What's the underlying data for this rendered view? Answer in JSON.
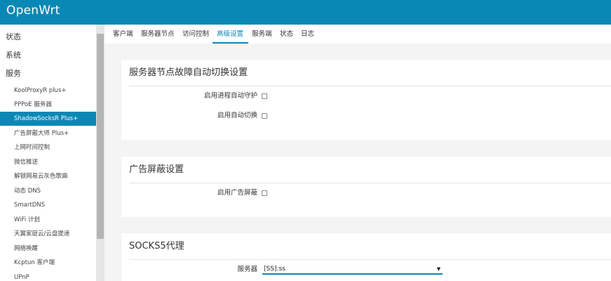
{
  "app": {
    "brand": "OpenWrt"
  },
  "colors": {
    "accent": "#0a88b5"
  },
  "sidebar": {
    "sections": [
      {
        "label": "状态"
      },
      {
        "label": "系统"
      },
      {
        "label": "服务"
      }
    ],
    "items": [
      {
        "label": "KoolProxyR plus+"
      },
      {
        "label": "PPPoE 服务器"
      },
      {
        "label": "ShadowSocksR Plus+",
        "active": true
      },
      {
        "label": "广告屏蔽大师 Plus+"
      },
      {
        "label": "上网时间控制"
      },
      {
        "label": "微信推送"
      },
      {
        "label": "解锁网易云灰色歌曲"
      },
      {
        "label": "动态 DNS"
      },
      {
        "label": "SmartDNS"
      },
      {
        "label": "WiFi 计划"
      },
      {
        "label": "天翼家庭云/云盘提速"
      },
      {
        "label": "网络唤醒"
      },
      {
        "label": "Kcptun 客户端"
      },
      {
        "label": "UPnP"
      }
    ]
  },
  "tabs": [
    {
      "label": "客户端"
    },
    {
      "label": "服务器节点"
    },
    {
      "label": "访问控制"
    },
    {
      "label": "高级设置",
      "active": true
    },
    {
      "label": "服务端"
    },
    {
      "label": "状态"
    },
    {
      "label": "日志"
    }
  ],
  "sections": {
    "failover": {
      "title": "服务器节点故障自动切换设置",
      "options": [
        {
          "label": "启用进程自动守护",
          "checked": false
        },
        {
          "label": "启用自动切换",
          "checked": false
        }
      ]
    },
    "adblock": {
      "title": "广告屏蔽设置",
      "options": [
        {
          "label": "启用广告屏蔽",
          "checked": false
        }
      ]
    },
    "socks5": {
      "title": "SOCKS5代理",
      "server_label": "服务器",
      "server_value": "[SS]:ss",
      "dropdown_icon": "triangle-down-icon"
    }
  }
}
